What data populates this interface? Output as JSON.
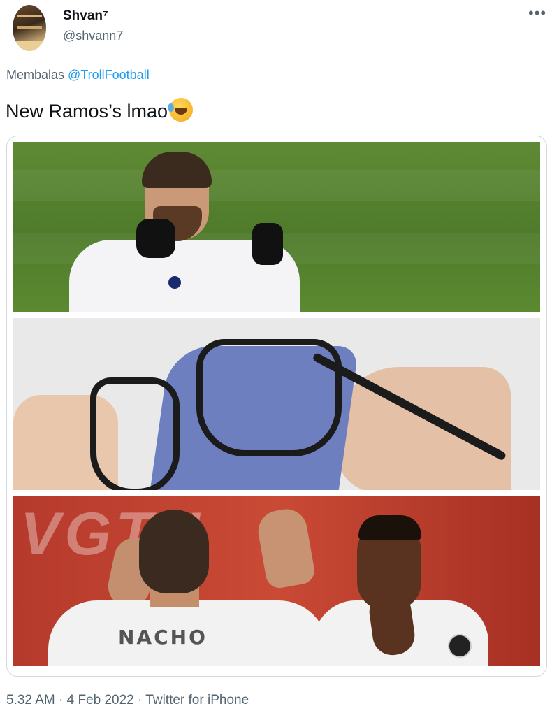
{
  "author": {
    "display_name": "Shvan⁷",
    "handle": "@shvann7",
    "avatar": "profile-avatar"
  },
  "more_icon": "•••",
  "reply": {
    "prefix": "Membalas",
    "mention": "@TrollFootball"
  },
  "tweet": {
    "text": "New Ramos’s lmao",
    "emoji": "rolling-on-floor-laughing-emoji"
  },
  "media": {
    "panels": [
      {
        "name": "player-gesture-photo"
      },
      {
        "name": "glasses-cleaning-photo"
      },
      {
        "name": "players-high-five-photo",
        "jersey_text": "NACHO"
      }
    ]
  },
  "footer": {
    "time": "5.32 AM",
    "date": "4 Feb 2022",
    "source": "Twitter for iPhone",
    "separator": "·"
  },
  "colors": {
    "link": "#1d9bf0",
    "secondary_text": "#536471",
    "primary_text": "#0f1419",
    "media_border": "#cfd9de"
  }
}
